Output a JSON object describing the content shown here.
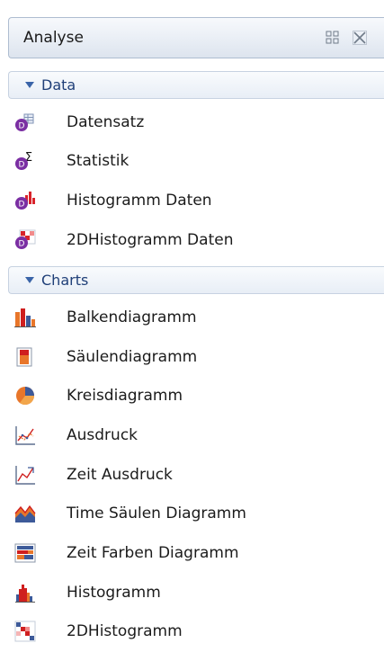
{
  "panel": {
    "title": "Analyse",
    "maximize_icon": "maximize-icon",
    "close_icon": "close-icon"
  },
  "sections": [
    {
      "label": "Data",
      "items": [
        {
          "label": "Datensatz",
          "icon": "dataset-icon"
        },
        {
          "label": "Statistik",
          "icon": "statistics-icon"
        },
        {
          "label": "Histogramm Daten",
          "icon": "histogram-data-icon"
        },
        {
          "label": "2DHistogramm Daten",
          "icon": "2d-histogram-data-icon"
        }
      ]
    },
    {
      "label": "Charts",
      "items": [
        {
          "label": "Balkendiagramm",
          "icon": "bar-chart-icon"
        },
        {
          "label": "Säulendiagramm",
          "icon": "column-chart-icon"
        },
        {
          "label": "Kreisdiagramm",
          "icon": "pie-chart-icon"
        },
        {
          "label": "Ausdruck",
          "icon": "plot-icon"
        },
        {
          "label": "Zeit Ausdruck",
          "icon": "time-plot-icon"
        },
        {
          "label": "Time Säulen Diagramm",
          "icon": "time-column-chart-icon"
        },
        {
          "label": "Zeit Farben Diagramm",
          "icon": "time-color-chart-icon"
        },
        {
          "label": "Histogramm",
          "icon": "histogram-icon"
        },
        {
          "label": "2DHistogramm",
          "icon": "2d-histogram-icon"
        }
      ]
    }
  ],
  "colors": {
    "accent": "#7b2fa3",
    "section_text": "#1f3f78",
    "triangle": "#3a64a8"
  }
}
